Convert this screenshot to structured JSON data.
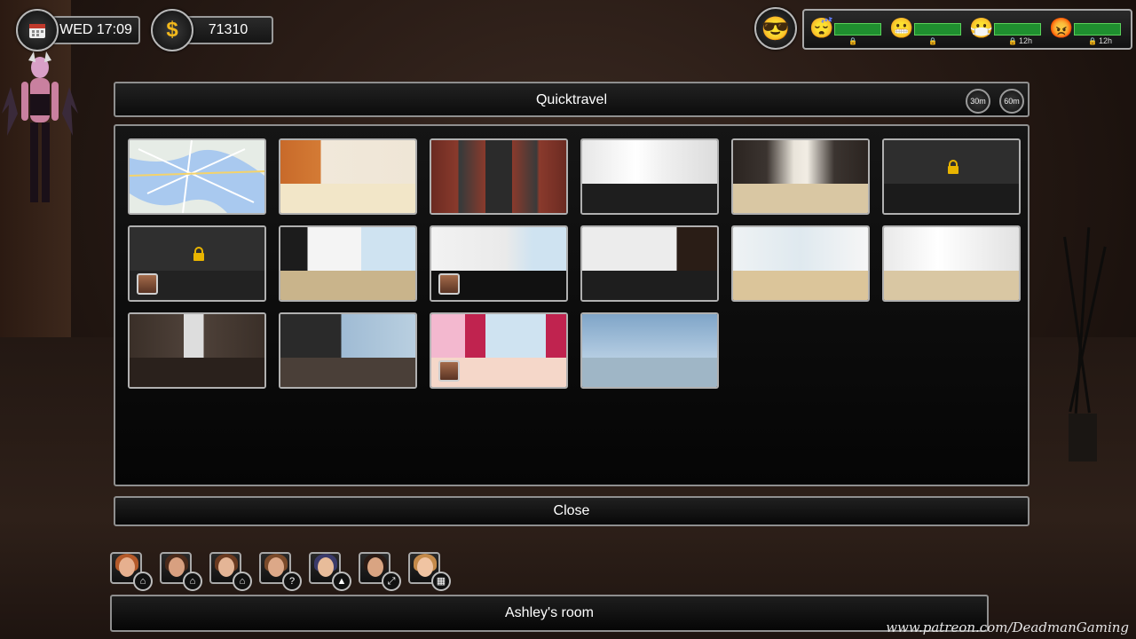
{
  "hud": {
    "datetime": "WED 17:09",
    "money": "71310",
    "calendar_icon": "calendar-icon",
    "money_icon": "dollar-icon",
    "mood_icon": "sunglasses-face-icon",
    "needs": [
      {
        "icon": "sleepy-face-icon",
        "emoji": "😴",
        "level": 0.95,
        "timer": ""
      },
      {
        "icon": "grimace-face-icon",
        "emoji": "😬",
        "level": 0.95,
        "timer": ""
      },
      {
        "icon": "mask-face-icon",
        "emoji": "😷",
        "level": 0.95,
        "timer": "12h"
      },
      {
        "icon": "angry-face-icon",
        "emoji": "😡",
        "level": 0.95,
        "timer": "12h"
      }
    ]
  },
  "quicktravel": {
    "title": "Quicktravel",
    "time_buttons": [
      "30m",
      "60m"
    ],
    "close_label": "Close"
  },
  "location_label": "Ashley's room",
  "watermark": "www.patreon.com/DeadmanGaming",
  "characters": [
    {
      "badge_icon": "home-icon",
      "badge": "⌂"
    },
    {
      "badge_icon": "home-icon",
      "badge": "⌂"
    },
    {
      "badge_icon": "home-icon",
      "badge": "⌂"
    },
    {
      "badge_icon": "question-icon",
      "badge": "?"
    },
    {
      "badge_icon": "police-hat-icon",
      "badge": "▲"
    },
    {
      "badge_icon": "expand-icon",
      "badge": "⤢"
    },
    {
      "badge_icon": "building-icon",
      "badge": "▦"
    }
  ],
  "colors": {
    "need_bar": "#1f8f2f",
    "lock": "#e8b400",
    "border": "#8f8f8f"
  }
}
